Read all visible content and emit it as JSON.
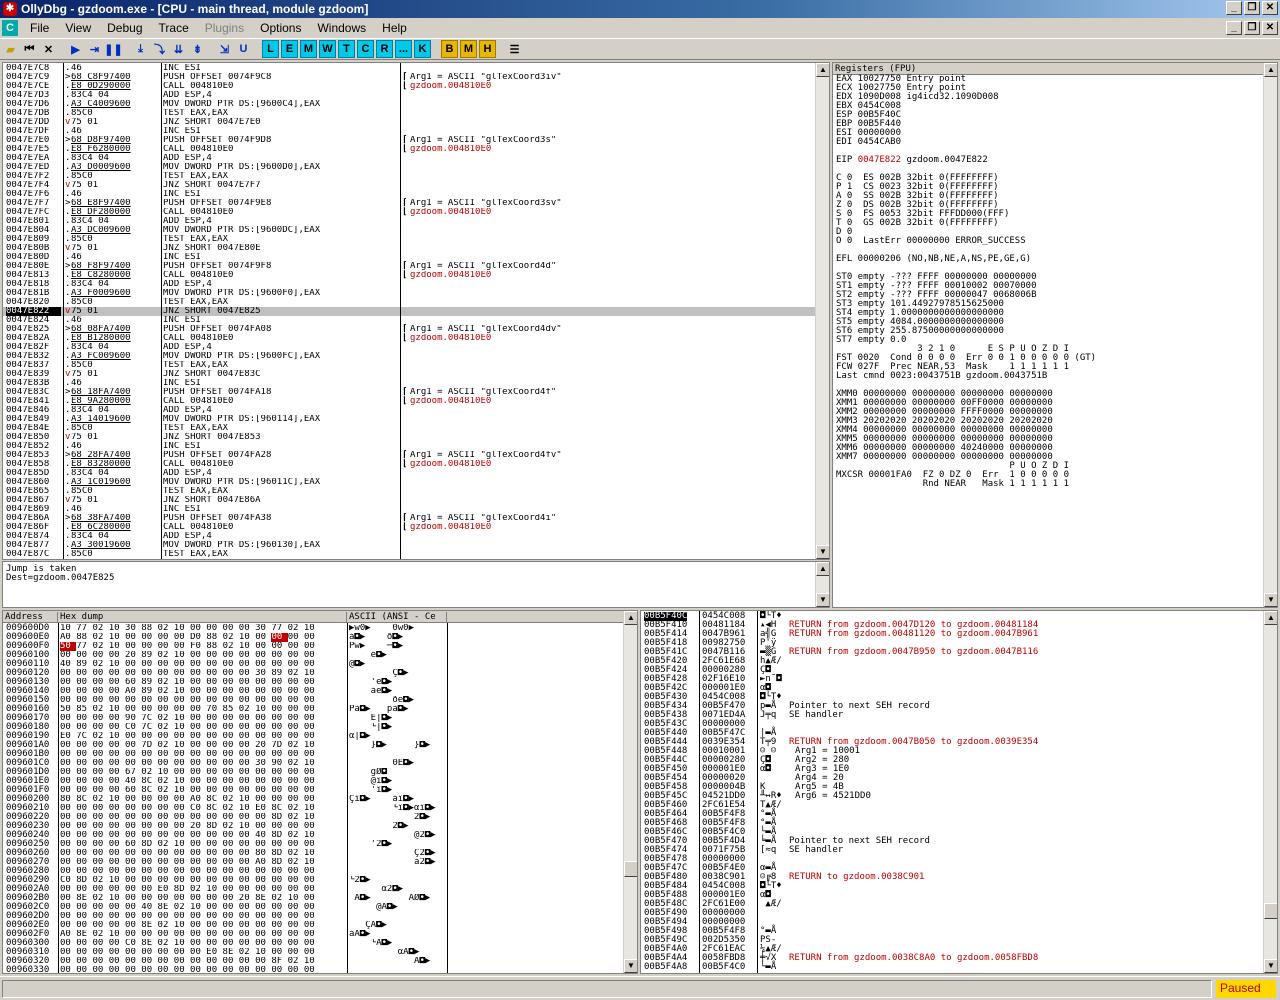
{
  "window": {
    "title": "OllyDbg - gzdoom.exe - [CPU - main thread, module gzdoom]"
  },
  "menu": {
    "items": [
      "File",
      "View",
      "Debug",
      "Trace",
      "Plugins",
      "Options",
      "Windows",
      "Help"
    ],
    "disabled": [
      4
    ]
  },
  "toolbar": {
    "letters": [
      "L",
      "E",
      "M",
      "W",
      "T",
      "C",
      "R",
      "...",
      "K"
    ],
    "gold": [
      "B",
      "M",
      "H"
    ]
  },
  "cpu": {
    "selected_index": 27,
    "rows": [
      [
        "0047E7C8",
        ".",
        "46",
        "INC ESI",
        "",
        ""
      ],
      [
        "0047E7C9",
        ">",
        "68 C8F97400",
        "PUSH OFFSET 0074F9C8",
        "Arg1 = ASCII \"glTexCoord3iv\"",
        "u1"
      ],
      [
        "0047E7CE",
        ".",
        "E8 0D290000",
        "CALL 004810E0",
        "gzdoom.004810E0",
        "u1"
      ],
      [
        "0047E7D3",
        ".",
        "83C4 04",
        "ADD ESP,4",
        "",
        ""
      ],
      [
        "0047E7D6",
        ".",
        "A3 C4009600",
        "MOV DWORD PTR DS:[9600C4],EAX",
        "",
        "u1"
      ],
      [
        "0047E7DB",
        ".",
        "85C0",
        "TEST EAX,EAX",
        "",
        ""
      ],
      [
        "0047E7DD",
        "v",
        "75 01",
        "JNZ SHORT 0047E7E0",
        "",
        ""
      ],
      [
        "0047E7DF",
        ".",
        "46",
        "INC ESI",
        "",
        ""
      ],
      [
        "0047E7E0",
        ">",
        "68 D8F97400",
        "PUSH OFFSET 0074F9D8",
        "Arg1 = ASCII \"glTexCoord3s\"",
        "u1"
      ],
      [
        "0047E7E5",
        ".",
        "E8 F6280000",
        "CALL 004810E0",
        "gzdoom.004810E0",
        "u1"
      ],
      [
        "0047E7EA",
        ".",
        "83C4 04",
        "ADD ESP,4",
        "",
        ""
      ],
      [
        "0047E7ED",
        ".",
        "A3 D0009600",
        "MOV DWORD PTR DS:[9600D0],EAX",
        "",
        "u1"
      ],
      [
        "0047E7F2",
        ".",
        "85C0",
        "TEST EAX,EAX",
        "",
        ""
      ],
      [
        "0047E7F4",
        "v",
        "75 01",
        "JNZ SHORT 0047E7F7",
        "",
        ""
      ],
      [
        "0047E7F6",
        ".",
        "46",
        "INC ESI",
        "",
        ""
      ],
      [
        "0047E7F7",
        ">",
        "68 E8F97400",
        "PUSH OFFSET 0074F9E8",
        "Arg1 = ASCII \"glTexCoord3sv\"",
        "u1"
      ],
      [
        "0047E7FC",
        ".",
        "E8 DF280000",
        "CALL 004810E0",
        "gzdoom.004810E0",
        "u1"
      ],
      [
        "0047E801",
        ".",
        "83C4 04",
        "ADD ESP,4",
        "",
        ""
      ],
      [
        "0047E804",
        ".",
        "A3 DC009600",
        "MOV DWORD PTR DS:[9600DC],EAX",
        "",
        "u1"
      ],
      [
        "0047E809",
        ".",
        "85C0",
        "TEST EAX,EAX",
        "",
        ""
      ],
      [
        "0047E80B",
        "v",
        "75 01",
        "JNZ SHORT 0047E80E",
        "",
        ""
      ],
      [
        "0047E80D",
        ".",
        "46",
        "INC ESI",
        "",
        ""
      ],
      [
        "0047E80E",
        ">",
        "68 F8F97400",
        "PUSH OFFSET 0074F9F8",
        "Arg1 = ASCII \"glTexCoord4d\"",
        "u1"
      ],
      [
        "0047E813",
        ".",
        "E8 C8280000",
        "CALL 004810E0",
        "gzdoom.004810E0",
        "u1"
      ],
      [
        "0047E818",
        ".",
        "83C4 04",
        "ADD ESP,4",
        "",
        ""
      ],
      [
        "0047E81B",
        ".",
        "A3 F0009600",
        "MOV DWORD PTR DS:[9600F0],EAX",
        "",
        "u1"
      ],
      [
        "0047E820",
        ".",
        "85C0",
        "TEST EAX,EAX",
        "",
        ""
      ],
      [
        "0047E822",
        "v",
        "75 01",
        "JNZ SHORT 0047E825",
        "",
        ""
      ],
      [
        "0047E824",
        ".",
        "46",
        "INC ESI",
        "",
        ""
      ],
      [
        "0047E825",
        ">",
        "68 08FA7400",
        "PUSH OFFSET 0074FA08",
        "Arg1 = ASCII \"glTexCoord4dv\"",
        "u1"
      ],
      [
        "0047E82A",
        ".",
        "E8 B1280000",
        "CALL 004810E0",
        "gzdoom.004810E0",
        "u1"
      ],
      [
        "0047E82F",
        ".",
        "83C4 04",
        "ADD ESP,4",
        "",
        ""
      ],
      [
        "0047E832",
        ".",
        "A3 FC009600",
        "MOV DWORD PTR DS:[9600FC],EAX",
        "",
        "u1"
      ],
      [
        "0047E837",
        ".",
        "85C0",
        "TEST EAX,EAX",
        "",
        ""
      ],
      [
        "0047E839",
        "v",
        "75 01",
        "JNZ SHORT 0047E83C",
        "",
        ""
      ],
      [
        "0047E83B",
        ".",
        "46",
        "INC ESI",
        "",
        ""
      ],
      [
        "0047E83C",
        ">",
        "68 18FA7400",
        "PUSH OFFSET 0074FA18",
        "Arg1 = ASCII \"glTexCoord4f\"",
        "u1"
      ],
      [
        "0047E841",
        ".",
        "E8 9A280000",
        "CALL 004810E0",
        "gzdoom.004810E0",
        "u1"
      ],
      [
        "0047E846",
        ".",
        "83C4 04",
        "ADD ESP,4",
        "",
        ""
      ],
      [
        "0047E849",
        ".",
        "A3 14019600",
        "MOV DWORD PTR DS:[960114],EAX",
        "",
        "u1"
      ],
      [
        "0047E84E",
        ".",
        "85C0",
        "TEST EAX,EAX",
        "",
        ""
      ],
      [
        "0047E850",
        "v",
        "75 01",
        "JNZ SHORT 0047E853",
        "",
        ""
      ],
      [
        "0047E852",
        ".",
        "46",
        "INC ESI",
        "",
        ""
      ],
      [
        "0047E853",
        ">",
        "68 28FA7400",
        "PUSH OFFSET 0074FA28",
        "Arg1 = ASCII \"glTexCoord4fv\"",
        "u1"
      ],
      [
        "0047E858",
        ".",
        "E8 83280000",
        "CALL 004810E0",
        "gzdoom.004810E0",
        "u1"
      ],
      [
        "0047E85D",
        ".",
        "83C4 04",
        "ADD ESP,4",
        "",
        ""
      ],
      [
        "0047E860",
        ".",
        "A3 1C019600",
        "MOV DWORD PTR DS:[96011C],EAX",
        "",
        "u1"
      ],
      [
        "0047E865",
        ".",
        "85C0",
        "TEST EAX,EAX",
        "",
        ""
      ],
      [
        "0047E867",
        "v",
        "75 01",
        "JNZ SHORT 0047E86A",
        "",
        ""
      ],
      [
        "0047E869",
        ".",
        "46",
        "INC ESI",
        "",
        ""
      ],
      [
        "0047E86A",
        ">",
        "68 38FA7400",
        "PUSH OFFSET 0074FA38",
        "Arg1 = ASCII \"glTexCoord4i\"",
        "u1"
      ],
      [
        "0047E86F",
        ".",
        "E8 6C280000",
        "CALL 004810E0",
        "gzdoom.004810E0",
        "u1"
      ],
      [
        "0047E874",
        ".",
        "83C4 04",
        "ADD ESP,4",
        "",
        ""
      ],
      [
        "0047E877",
        ".",
        "A3 30019600",
        "MOV DWORD PTR DS:[960130],EAX",
        "",
        "u1"
      ],
      [
        "0047E87C",
        ".",
        "85C0",
        "TEST EAX,EAX",
        "",
        ""
      ]
    ]
  },
  "info": {
    "line1": "Jump is taken",
    "line2": "Dest=gzdoom.0047E825"
  },
  "registers": {
    "title": "Registers (FPU)",
    "lines": [
      "EAX 10027750 Entry point",
      "ECX 10027750 Entry point",
      "EDX 1090D008 ig4icd32.1090D008",
      "EBX 0454C008",
      "ESP 00B5F40C",
      "EBP 00B5F440",
      "ESI 00000000",
      "EDI 0454CAB0",
      "",
      "EIP 0047E822 gzdoom.0047E822",
      "",
      "C 0  ES 002B 32bit 0(FFFFFFFF)",
      "P 1  CS 0023 32bit 0(FFFFFFFF)",
      "A 0  SS 002B 32bit 0(FFFFFFFF)",
      "Z 0  DS 002B 32bit 0(FFFFFFFF)",
      "S 0  FS 0053 32bit FFFDD000(FFF)",
      "T 0  GS 002B 32bit 0(FFFFFFFF)",
      "D 0",
      "O 0  LastErr 00000000 ERROR_SUCCESS",
      "",
      "EFL 00000206 (NO,NB,NE,A,NS,PE,GE,G)",
      "",
      "ST0 empty -??? FFFF 00000000 00000000",
      "ST1 empty -??? FFFF 00010002 00070000",
      "ST2 empty -??? FFFF 00000047 0068006B",
      "ST3 empty 101.44927978515625000",
      "ST4 empty 1.0000000000000000000",
      "ST5 empty 4084.0000000000000000",
      "ST6 empty 255.87500000000000000",
      "ST7 empty 0.0",
      "               3 2 1 0      E S P U O Z D I",
      "FST 0020  Cond 0 0 0 0  Err 0 0 1 0 0 0 0 0 (GT)",
      "FCW 027F  Prec NEAR,53  Mask    1 1 1 1 1 1",
      "Last cmnd 0023:0043751B gzdoom.0043751B",
      "",
      "XMM0 00000000 00000000 00000000 00000000",
      "XMM1 00000000 00000000 00FF0000 00000000",
      "XMM2 00000000 00000000 FFFF0000 00000000",
      "XMM3 20202020 20202020 20202020 20202020",
      "XMM4 00000000 00000000 00000000 00000000",
      "XMM5 00000000 00000000 00000000 00000000",
      "XMM6 00000000 00000000 40240000 00000000",
      "XMM7 00000000 00000000 00000000 00000000",
      "                                P U O Z D I",
      "MXCSR 00001FA0  FZ 0 DZ 0  Err  1 0 0 0 0 0",
      "                Rnd NEAR   Mask 1 1 1 1 1 1"
    ],
    "red_index": 9
  },
  "dump": {
    "headers": [
      "Address",
      "Hex dump",
      "ASCII (ANSI - Ce"
    ],
    "rows": [
      [
        "009600D0",
        "10 77 02 10 30 88 02 10 00 00 00 00 30 77 02 10",
        "▶w0▶    0w0▶"
      ],
      [
        "009600E0",
        "A0 88 02 10 00 00 00 00 D0 88 02 10 00 00 00 00",
        "á◘▶    ð◘▶"
      ],
      [
        "009600F0",
        "50 77 02 10 00 00 00 00 F0 88 02 10 00 00 00 00",
        "Pw▶    ─◘▶"
      ],
      [
        "00960100",
        "00 00 00 00 20 89 02 10 00 00 00 00 00 00 00 00",
        "    é◘▶"
      ],
      [
        "00960110",
        "40 89 02 10 00 00 00 00 00 00 00 00 00 00 00 00",
        "@◘▶"
      ],
      [
        "00960120",
        "00 00 00 00 00 00 00 00 00 00 00 00 30 89 02 10",
        "        Ç◘▶"
      ],
      [
        "00960130",
        "00 00 00 00 60 89 02 10 00 00 00 00 00 00 00 00",
        "    'ë◘▶"
      ],
      [
        "00960140",
        "00 00 00 00 A0 89 02 10 00 00 00 00 00 00 00 00",
        "    áë◘▶"
      ],
      [
        "00960150",
        "00 00 00 00 00 00 00 00 00 00 00 00 00 00 00 00",
        "        ðë◘▶"
      ],
      [
        "00960160",
        "50 85 02 10 00 00 00 00 00 70 85 02 10 00 00 00",
        "Pà◘▶   pà◘▶"
      ],
      [
        "00960170",
        "00 00 00 00 90 7C 02 10 00 00 00 00 00 00 00 00",
        "    É|◘▶"
      ],
      [
        "00960180",
        "00 00 00 00 C0 7C 02 10 00 00 00 00 00 00 00 00",
        "    └|◘▶"
      ],
      [
        "00960190",
        "E0 7C 02 10 00 00 00 00 00 00 00 00 00 00 00 00",
        "α|◘▶"
      ],
      [
        "009601A0",
        "00 00 00 00 00 7D 02 10 00 00 00 00 20 7D 02 10",
        "    }◘▶     }◘▶"
      ],
      [
        "009601B0",
        "00 00 00 00 00 00 00 00 00 00 00 00 00 00 00 00",
        ""
      ],
      [
        "009601C0",
        "00 00 00 00 00 00 00 00 00 00 00 00 30 90 02 10",
        "        0É◘▶"
      ],
      [
        "009601D0",
        "00 00 00 00 67 02 10 00 00 00 00 00 00 00 00 00",
        "    gØ◘"
      ],
      [
        "009601E0",
        "00 00 00 00 40 8C 02 10 00 00 00 00 00 00 00 00",
        "    @î◘▶"
      ],
      [
        "009601F0",
        "00 00 00 00 60 8C 02 10 00 00 00 00 00 00 00 00",
        "    'î◘▶"
      ],
      [
        "00960200",
        "80 8C 02 10 00 00 00 00 A0 8C 02 10 00 00 00 00",
        "Çî◘▶    áî◘▶"
      ],
      [
        "00960210",
        "00 00 00 00 00 00 00 00 C0 8C 02 10 E0 8C 02 10",
        "        └î◘▶αî◘▶"
      ],
      [
        "00960220",
        "00 00 00 00 00 00 00 00 00 00 00 00 00 8D 02 10",
        "            2◘▶"
      ],
      [
        "00960230",
        "00 00 00 00 00 00 00 00 20 8D 02 10 00 00 00 00",
        "        2◘▶"
      ],
      [
        "00960240",
        "00 00 00 00 00 00 00 00 00 00 00 00 40 8D 02 10",
        "            @2◘▶"
      ],
      [
        "00960250",
        "00 00 00 00 60 8D 02 10 00 00 00 00 00 00 00 00",
        "    '2◘▶"
      ],
      [
        "00960260",
        "00 00 00 00 00 00 00 00 00 00 00 00 80 8D 02 10",
        "            Ç2◘▶"
      ],
      [
        "00960270",
        "00 00 00 00 00 00 00 00 00 00 00 00 A0 8D 02 10",
        "            á2◘▶"
      ],
      [
        "00960280",
        "00 00 00 00 00 00 00 00 00 00 00 00 00 00 00 00",
        ""
      ],
      [
        "00960290",
        "C0 8D 02 10 00 00 00 00 00 00 00 00 00 00 00 00",
        "└2◘▶"
      ],
      [
        "009602A0",
        "00 00 00 00 00 00 E0 8D 02 10 00 00 00 00 00 00",
        "      α2◘▶"
      ],
      [
        "009602B0",
        "00 8E 02 10 00 00 00 00 00 00 00 20 8E 02 10 00",
        " Ä◘▶       ÄØ◘▶"
      ],
      [
        "009602C0",
        "00 00 00 00 00 40 8E 02 10 00 00 00 00 00 00 00",
        "     @Ä◘▶"
      ],
      [
        "009602D0",
        "00 00 00 00 00 00 00 00 00 00 00 00 00 00 00 00",
        ""
      ],
      [
        "009602E0",
        "00 00 00 00 00 8E 02 10 00 00 00 00 00 00 00 00",
        "   ÇÄ◘▶"
      ],
      [
        "009602F0",
        "A0 8E 02 10 00 00 00 00 00 00 00 00 00 00 00 00",
        "áÄ◘▶"
      ],
      [
        "00960300",
        "00 00 00 00 C0 8E 02 10 00 00 00 00 00 00 00 00",
        "    └Ä◘▶"
      ],
      [
        "00960310",
        "00 00 00 00 00 00 00 00 00 E0 8E 02 10 00 00 00",
        "         αÄ◘▶"
      ],
      [
        "00960320",
        "00 00 00 00 00 00 00 00 00 00 00 00 00 8F 02 10",
        "            Å◘▶"
      ],
      [
        "00960330",
        "00 00 00 00 00 00 00 00 00 00 00 00 00 00 00 00",
        ""
      ]
    ]
  },
  "stack": {
    "rows": [
      [
        "00B5F40C",
        "0454C008",
        "◘└T♦",
        ""
      ],
      [
        "00B5F410",
        "00481184",
        "▴◀H",
        "RETURN from gzdoom.0047D120 to gzdoom.00481184"
      ],
      [
        "00B5F414",
        "0047B961",
        "a╣G",
        "RETURN from gzdoom.00481120 to gzdoom.0047B961"
      ],
      [
        "00B5F418",
        "00982750",
        "P'ÿ",
        ""
      ],
      [
        "00B5F41C",
        "0047B116",
        "▬▒G",
        "RETURN from gzdoom.0047B950 to gzdoom.0047B116"
      ],
      [
        "00B5F420",
        "2FC61E68",
        "h▲Æ/",
        ""
      ],
      [
        "00B5F424",
        "00000280",
        "Ç◘",
        ""
      ],
      [
        "00B5F428",
        "02F16E10",
        "►n˜◘",
        ""
      ],
      [
        "00B5F42C",
        "000001E0",
        "α◘",
        ""
      ],
      [
        "00B5F430",
        "0454C008",
        "◘└T♦",
        ""
      ],
      [
        "00B5F434",
        "00B5F470",
        "p▬Å",
        "Pointer to next SEH record"
      ],
      [
        "00B5F438",
        "0071ED4A",
        "J╤q",
        "SE handler"
      ],
      [
        "00B5F43C",
        "00000000",
        "",
        ""
      ],
      [
        "00B5F440",
        "00B5F47C",
        "|▬Å",
        ""
      ],
      [
        "00B5F444",
        "0039E354",
        "T╤9",
        "RETURN from gzdoom.0047B050 to gzdoom.0039E354"
      ],
      [
        "00B5F448",
        "00010001",
        "☺ ☺",
        "Arg1 = 10001"
      ],
      [
        "00B5F44C",
        "00000280",
        "Ç◘",
        "Arg2 = 280"
      ],
      [
        "00B5F450",
        "000001E0",
        "α◘",
        "Arg3 = 1E0"
      ],
      [
        "00B5F454",
        "00000020",
        "",
        "Arg4 = 20"
      ],
      [
        "00B5F458",
        "0000004B",
        "K",
        "Arg5 = 4B"
      ],
      [
        "00B5F45C",
        "04521DD0",
        "╨↔R♦",
        "Arg6 = 4521DD0"
      ],
      [
        "00B5F460",
        "2FC61E54",
        "T▲Æ/",
        ""
      ],
      [
        "00B5F464",
        "00B5F4F8",
        "°▬Å",
        ""
      ],
      [
        "00B5F468",
        "00B5F4F8",
        "°▬Å",
        ""
      ],
      [
        "00B5F46C",
        "00B5F4C0",
        "└▬Å",
        ""
      ],
      [
        "00B5F470",
        "00B5F4D4",
        "╘▬Å",
        "Pointer to next SEH record"
      ],
      [
        "00B5F474",
        "0071F75B",
        "[≈q",
        "SE handler"
      ],
      [
        "00B5F478",
        "00000000",
        "",
        ""
      ],
      [
        "00B5F47C",
        "00B5F4E0",
        "α▬Å",
        ""
      ],
      [
        "00B5F480",
        "0038C901",
        "☺╔8",
        "RETURN to gzdoom.0038C901"
      ],
      [
        "00B5F484",
        "0454C008",
        "◘└T♦",
        ""
      ],
      [
        "00B5F488",
        "000001E0",
        "α◘",
        ""
      ],
      [
        "00B5F48C",
        "2FC61E00",
        " ▲Æ/",
        ""
      ],
      [
        "00B5F490",
        "00000000",
        "",
        ""
      ],
      [
        "00B5F494",
        "00000000",
        "",
        ""
      ],
      [
        "00B5F498",
        "00B5F4F8",
        "°▬Å",
        ""
      ],
      [
        "00B5F49C",
        "002D5350",
        "PS-",
        ""
      ],
      [
        "00B5F4A0",
        "2FC61EAC",
        "¼▲Æ/",
        ""
      ],
      [
        "00B5F4A4",
        "0058FBD8",
        "╪√X",
        "RETURN from gzdoom.0038C8A0 to gzdoom.0058FBD8"
      ],
      [
        "00B5F4A8",
        "00B5F4C0",
        "└▬Å",
        ""
      ]
    ]
  },
  "status": {
    "state": "Paused"
  }
}
